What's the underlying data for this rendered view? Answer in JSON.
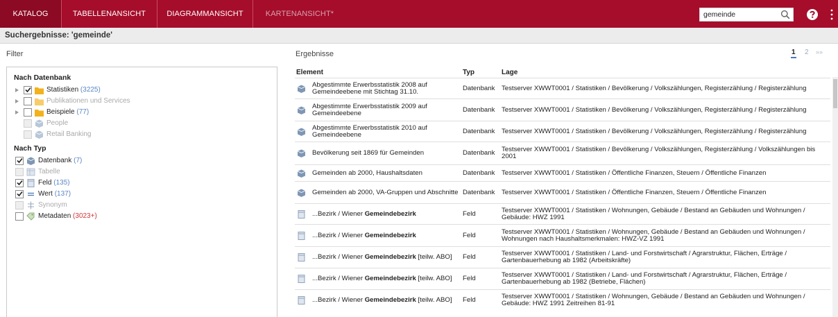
{
  "topbar": {
    "tabs": [
      {
        "label": "KATALOG",
        "state": "active"
      },
      {
        "label": "TABELLENANSICHT",
        "state": "normal"
      },
      {
        "label": "DIAGRAMMANSICHT",
        "state": "normal"
      },
      {
        "label": "KARTENANSICHT*",
        "state": "disabled"
      }
    ],
    "search_value": "gemeinde",
    "brand_color": "#a50d2b"
  },
  "title": "Suchergebnisse: 'gemeinde'",
  "filter": {
    "heading": "Filter",
    "by_database": {
      "heading": "Nach Datenbank",
      "items": [
        {
          "label": "Statistiken",
          "count": "(3225)",
          "checked": true,
          "icon": "folder-icon"
        },
        {
          "label": "Publikationen und Services",
          "count": "",
          "checked": false,
          "icon": "folder-icon"
        },
        {
          "label": "Beispiele",
          "count": "(77)",
          "checked": false,
          "icon": "folder-icon"
        },
        {
          "label": "People",
          "count": "",
          "checked": false,
          "icon": "database-icon"
        },
        {
          "label": "Retail Banking",
          "count": "",
          "checked": false,
          "icon": "database-icon"
        }
      ]
    },
    "by_type": {
      "heading": "Nach Typ",
      "items": [
        {
          "label": "Datenbank",
          "count": "(7)",
          "checked": true,
          "icon": "database-icon"
        },
        {
          "label": "Tabelle",
          "count": "",
          "checked": false,
          "icon": "table-icon"
        },
        {
          "label": "Feld",
          "count": "(135)",
          "checked": true,
          "icon": "field-icon"
        },
        {
          "label": "Wert",
          "count": "(137)",
          "checked": true,
          "icon": "value-icon"
        },
        {
          "label": "Synonym",
          "count": "",
          "checked": false,
          "icon": "synonym-icon"
        },
        {
          "label": "Metadaten",
          "count": "(3023+)",
          "checked": false,
          "icon": "tag-icon"
        }
      ]
    }
  },
  "results": {
    "heading": "Ergebnisse",
    "pager": {
      "current": "1",
      "next": "2",
      "more": "»»"
    },
    "columns": [
      "Element",
      "Typ",
      "Lage"
    ],
    "rows": [
      {
        "icon": "database-icon",
        "element": "Abgestimmte Erwerbsstatistik 2008 auf Gemeindeebene mit Stichtag 31.10.",
        "bold": "",
        "suffix": "",
        "type": "Datenbank",
        "location": "Testserver XWWT0001 / Statistiken / Bevölkerung / Volkszählungen, Registerzählung / Registerzählung"
      },
      {
        "icon": "database-icon",
        "element": "Abgestimmte Erwerbsstatistik 2009 auf Gemeindeebene",
        "bold": "",
        "suffix": "",
        "type": "Datenbank",
        "location": "Testserver XWWT0001 / Statistiken / Bevölkerung / Volkszählungen, Registerzählung / Registerzählung"
      },
      {
        "icon": "database-icon",
        "element": "Abgestimmte Erwerbsstatistik 2010 auf Gemeindeebene",
        "bold": "",
        "suffix": "",
        "type": "Datenbank",
        "location": "Testserver XWWT0001 / Statistiken / Bevölkerung / Volkszählungen, Registerzählung / Registerzählung"
      },
      {
        "icon": "database-icon",
        "element": "Bevölkerung seit 1869 für Gemeinden",
        "bold": "",
        "suffix": "",
        "type": "Datenbank",
        "location": "Testserver XWWT0001 / Statistiken / Bevölkerung / Volkszählungen, Registerzählung / Volkszählungen bis 2001"
      },
      {
        "icon": "database-icon",
        "element": "Gemeinden ab 2000, Haushaltsdaten",
        "bold": "",
        "suffix": "",
        "type": "Datenbank",
        "location": "Testserver XWWT0001 / Statistiken / Öffentliche Finanzen, Steuern / Öffentliche Finanzen"
      },
      {
        "icon": "database-icon",
        "element": "Gemeinden ab 2000, VA-Gruppen und Abschnitte",
        "bold": "",
        "suffix": "",
        "type": "Datenbank",
        "location": "Testserver XWWT0001 / Statistiken / Öffentliche Finanzen, Steuern / Öffentliche Finanzen"
      },
      {
        "icon": "field-icon",
        "element": "...Bezirk / Wiener ",
        "bold": "Gemeindebezirk",
        "suffix": "",
        "type": "Feld",
        "location": "Testserver XWWT0001 / Statistiken / Wohnungen, Gebäude / Bestand an Gebäuden und Wohnungen / Gebäude: HWZ 1991"
      },
      {
        "icon": "field-icon",
        "element": "...Bezirk / Wiener ",
        "bold": "Gemeindebezirk",
        "suffix": "",
        "type": "Feld",
        "location": "Testserver XWWT0001 / Statistiken / Wohnungen, Gebäude / Bestand an Gebäuden und Wohnungen / Wohnungen nach Haushaltsmerkmalen: HWZ-VZ 1991"
      },
      {
        "icon": "field-icon",
        "element": "...Bezirk / Wiener ",
        "bold": "Gemeindebezirk",
        "suffix": " [teilw. ABO]",
        "type": "Feld",
        "location": "Testserver XWWT0001 / Statistiken / Land- und Forstwirtschaft / Agrarstruktur, Flächen, Erträge / Gartenbauerhebung ab 1982 (Arbeitskräfte)"
      },
      {
        "icon": "field-icon",
        "element": "...Bezirk / Wiener ",
        "bold": "Gemeindebezirk",
        "suffix": " [teilw. ABO]",
        "type": "Feld",
        "location": "Testserver XWWT0001 / Statistiken / Land- und Forstwirtschaft / Agrarstruktur, Flächen, Erträge / Gartenbauerhebung ab 1982 (Betriebe, Flächen)"
      },
      {
        "icon": "field-icon",
        "element": "...Bezirk / Wiener ",
        "bold": "Gemeindebezirk",
        "suffix": " [teilw. ABO]",
        "type": "Feld",
        "location": "Testserver XWWT0001 / Statistiken / Wohnungen, Gebäude / Bestand an Gebäuden und Wohnungen / Gebäude: HWZ 1991 Zeitreihen 81-91"
      }
    ]
  }
}
